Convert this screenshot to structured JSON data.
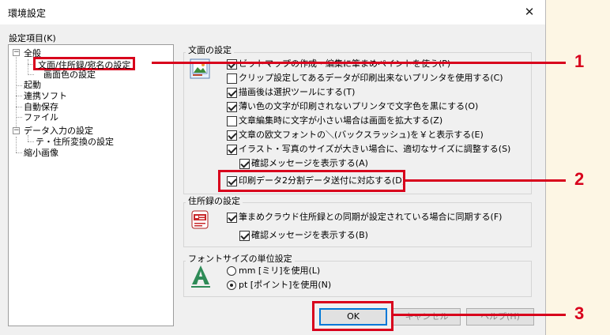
{
  "window": {
    "title": "環境設定",
    "close_glyph": "✕"
  },
  "tree": {
    "label": "設定項目(K)",
    "items": [
      {
        "label": "全般",
        "expander": "−"
      },
      {
        "label": "文面/住所録/宛名の設定"
      },
      {
        "label": "画面色の設定"
      },
      {
        "label": "起動"
      },
      {
        "label": "連携ソフト"
      },
      {
        "label": "自動保存"
      },
      {
        "label": "ファイル"
      },
      {
        "label": "データ入力の設定",
        "expander": "−"
      },
      {
        "label": "テ・住所変換の設定"
      },
      {
        "label": "縮小画像"
      }
    ]
  },
  "bunmen": {
    "title": "文面の設定",
    "icon": "document-image-icon",
    "options": [
      {
        "label": "ビットマップの作成・編集に筆まめペイントを使う(P)",
        "checked": true
      },
      {
        "label": "クリップ設定してあるデータが印刷出来ないプリンタを使用する(C)",
        "checked": false
      },
      {
        "label": "描画後は選択ツールにする(T)",
        "checked": true
      },
      {
        "label": "薄い色の文字が印刷されないプリンタで文字色を黒にする(O)",
        "checked": true
      },
      {
        "label": "文章編集時に文字が小さい場合は画面を拡大する(Z)",
        "checked": false
      },
      {
        "label": "文章の欧文フォントの＼(バックスラッシュ)を￥と表示する(E)",
        "checked": true
      },
      {
        "label": "イラスト・写真のサイズが大きい場合に、適切なサイズに調整する(S)",
        "checked": true
      },
      {
        "label": "確認メッセージを表示する(A)",
        "checked": true
      },
      {
        "label": "印刷データ2分割データ送付に対応する(D)",
        "checked": true
      }
    ]
  },
  "address": {
    "title": "住所録の設定",
    "icon": "address-book-icon",
    "options": [
      {
        "label": "筆まめクラウド住所録との同期が設定されている場合に同期する(F)",
        "checked": true
      },
      {
        "label": "確認メッセージを表示する(B)",
        "checked": true
      }
    ]
  },
  "fontsize": {
    "title": "フォントサイズの単位設定",
    "icon": "font-a-icon",
    "options": [
      {
        "label": "mm [ミリ]を使用(L)",
        "selected": false
      },
      {
        "label": "pt [ポイント]を使用(N)",
        "selected": true
      }
    ]
  },
  "buttons": {
    "ok": "OK",
    "cancel": "キャンセル",
    "help": "ヘルプ(H)"
  },
  "callouts": [
    "1",
    "2",
    "3"
  ],
  "colors": {
    "annotation": "#d8001c",
    "default_button_border": "#0078d7"
  }
}
